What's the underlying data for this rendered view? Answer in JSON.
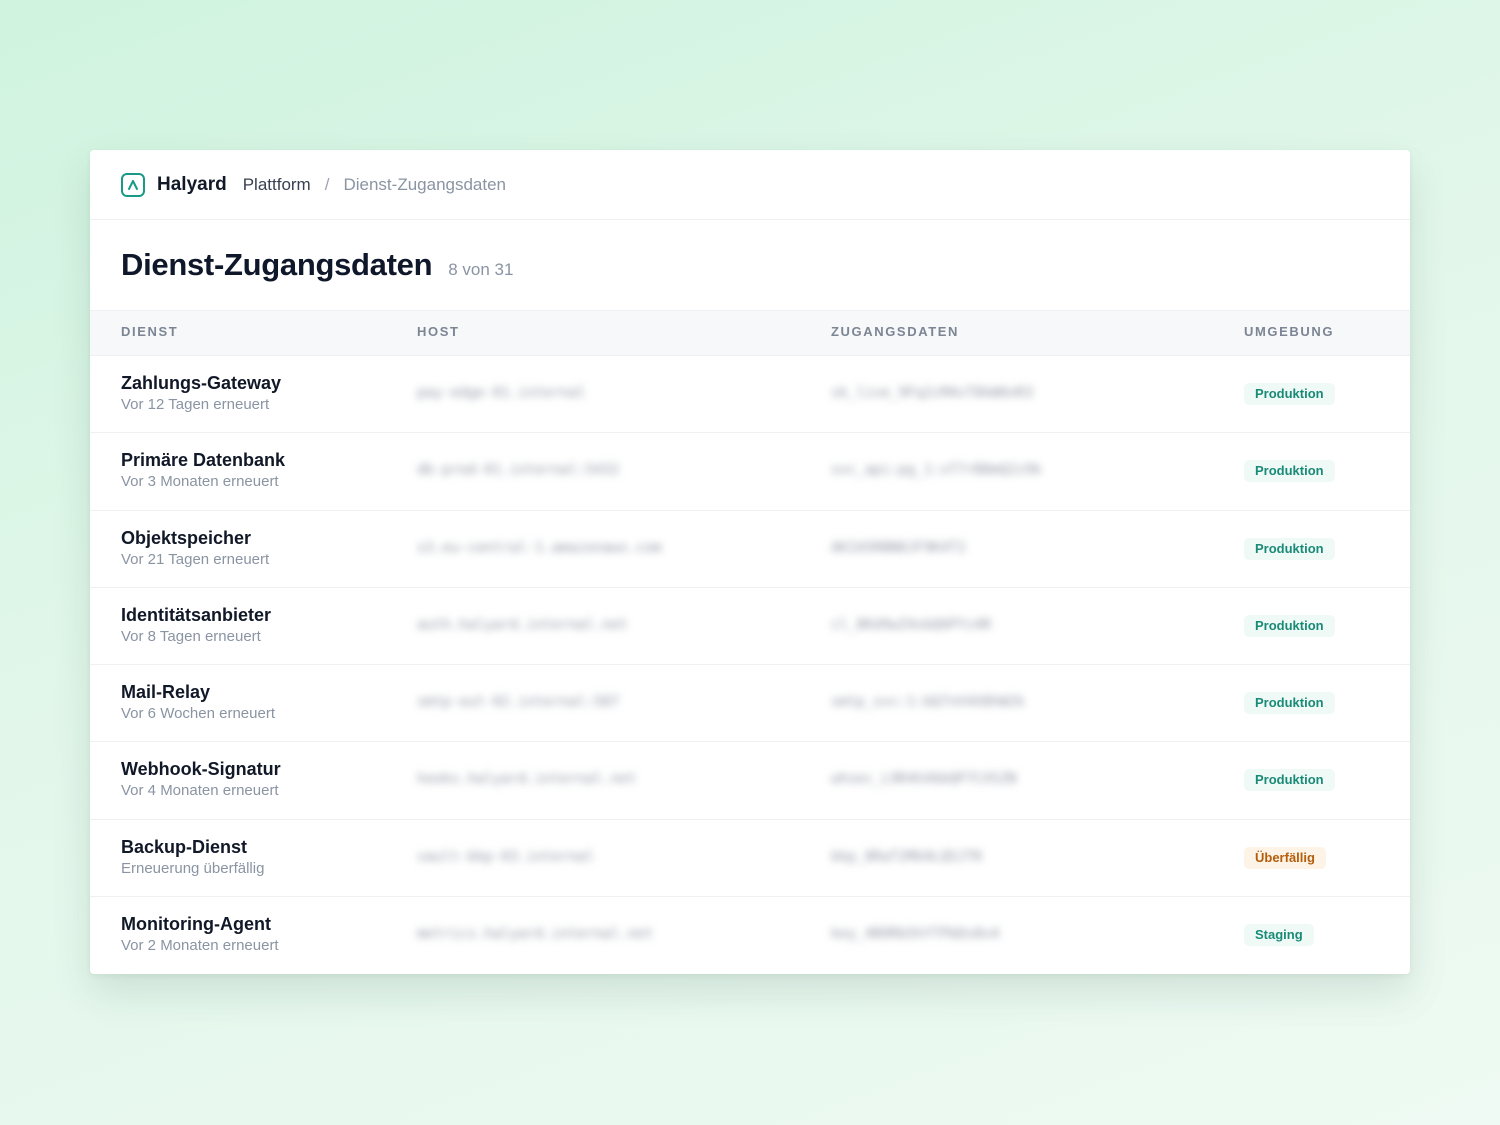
{
  "header": {
    "brand": "Halyard",
    "breadcrumb_root": "Plattform",
    "breadcrumb_sep": "/",
    "breadcrumb_current": "Dienst-Zugangsdaten",
    "logo_icon": "chevron-up-icon"
  },
  "page": {
    "title": "Dienst-Zugangsdaten",
    "count": "8 von 31"
  },
  "table": {
    "columns": [
      "DIENST",
      "HOST",
      "ZUGANGSDATEN",
      "UMGEBUNG"
    ],
    "rows": [
      {
        "name": "Zahlungs-Gateway",
        "sub": "Vor 12 Tagen erneuert",
        "host": "pay-edge-01.internal",
        "cred": "sk_live_9Fq2cM4vT8kW6nR3",
        "env": "Produktion",
        "env_type": "prod"
      },
      {
        "name": "Primäre Datenbank",
        "sub": "Vor 3 Monaten erneuert",
        "host": "db-prod-01.internal:5432",
        "cred": "svc_api:pg_1:xT7rB8mQ2z9k",
        "env": "Produktion",
        "env_type": "prod"
      },
      {
        "name": "Objektspeicher",
        "sub": "Vor 21 Tagen erneuert",
        "host": "s3.eu-central-1.amazonaws.com",
        "cred": "AKIA5RBN8JF9K4T2",
        "env": "Produktion",
        "env_type": "prod"
      },
      {
        "name": "Identitätsanbieter",
        "sub": "Vor 8 Tagen erneuert",
        "host": "auth.halyard.internal.net",
        "cred": "cl_8Kd9wZ4xbQ6PYz4R",
        "env": "Produktion",
        "env_type": "prod"
      },
      {
        "name": "Mail-Relay",
        "sub": "Vor 6 Wochen erneuert",
        "host": "smtp-out-02.internal:587",
        "cred": "smtp_svc:1:bQ7nV4X8hW2k",
        "env": "Produktion",
        "env_type": "prod"
      },
      {
        "name": "Webhook-Signatur",
        "sub": "Vor 4 Monaten erneuert",
        "host": "hooks.halyard.internal.net",
        "cred": "whsec_L9R4hX6bQP7CX5ZN",
        "env": "Produktion",
        "env_type": "prod"
      },
      {
        "name": "Backup-Dienst",
        "sub": "Erneuerung überfällig",
        "host": "vault-bkp-03.internal",
        "cred": "bkp_8RaT2MU4LQ5JTK",
        "env": "Überfällig",
        "env_type": "overdue"
      },
      {
        "name": "Monitoring-Agent",
        "sub": "Vor 2 Monaten erneuert",
        "host": "metrics.halyard.internal.net",
        "cred": "key_4N9Rb5hYTPbDs8x4",
        "env": "Staging",
        "env_type": "stage"
      }
    ]
  },
  "colors": {
    "accent": "#1a9a86",
    "badge_prod_bg": "#effaf6",
    "badge_prod_text": "#1a8a77",
    "badge_overdue_bg": "#fdf3e6",
    "badge_overdue_text": "#b45d0a"
  }
}
